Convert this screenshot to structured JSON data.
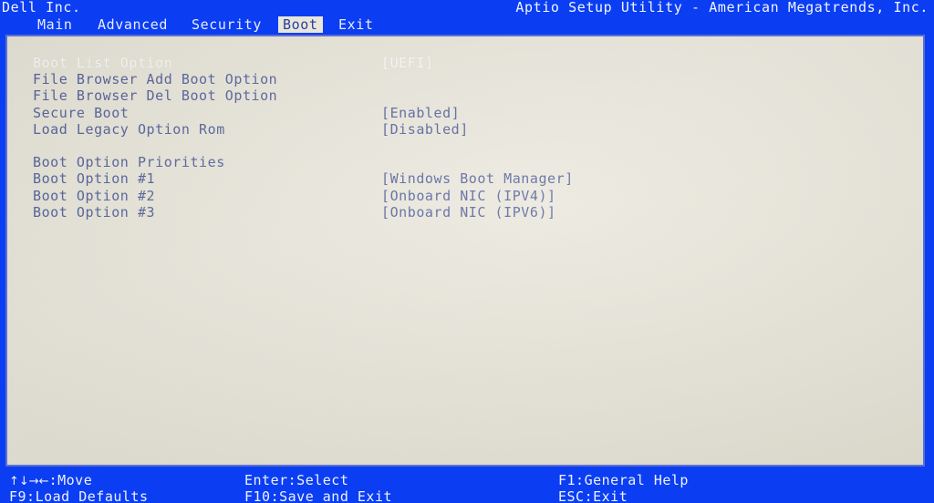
{
  "header": {
    "vendor": "Dell Inc.",
    "utility_title": "Aptio Setup Utility - American Megatrends, Inc."
  },
  "colors": {
    "blue": "#0b3ef2",
    "panel_bg": "#e7e4d8",
    "text": "#52619a",
    "selected_text": "#fbfaf5",
    "tab_active_bg": "#e9e6da",
    "tab_active_text": "#2a3f9e",
    "border": "#5c6fd0"
  },
  "tabs": [
    {
      "label": "Main",
      "active": false
    },
    {
      "label": "Advanced",
      "active": false
    },
    {
      "label": "Security",
      "active": false
    },
    {
      "label": "Boot",
      "active": true
    },
    {
      "label": "Exit",
      "active": false
    }
  ],
  "main": {
    "rows": [
      {
        "label": "Boot List Option",
        "value": "[UEFI]",
        "selected": true
      },
      {
        "label": "File Browser Add Boot Option",
        "value": "",
        "selected": false
      },
      {
        "label": "File Browser Del Boot Option",
        "value": "",
        "selected": false
      },
      {
        "label": "Secure Boot",
        "value": "[Enabled]",
        "selected": false
      },
      {
        "label": "Load Legacy Option Rom",
        "value": "[Disabled]",
        "selected": false
      },
      {
        "label": "",
        "value": "",
        "selected": false
      },
      {
        "label": "Boot Option Priorities",
        "value": "",
        "selected": false
      },
      {
        "label": "Boot Option #1",
        "value": "[Windows Boot Manager]",
        "selected": false
      },
      {
        "label": "Boot Option #2",
        "value": "[Onboard NIC (IPV4)]",
        "selected": false
      },
      {
        "label": "Boot Option #3",
        "value": "[Onboard NIC (IPV6)]",
        "selected": false
      }
    ]
  },
  "footer": {
    "move_arrows": "↑↓→←",
    "move_label": ":Move",
    "enter_select": "Enter:Select",
    "general_help": "F1:General Help",
    "load_defaults": "F9:Load Defaults",
    "save_and_exit": "F10:Save and Exit",
    "esc_exit": "ESC:Exit"
  }
}
